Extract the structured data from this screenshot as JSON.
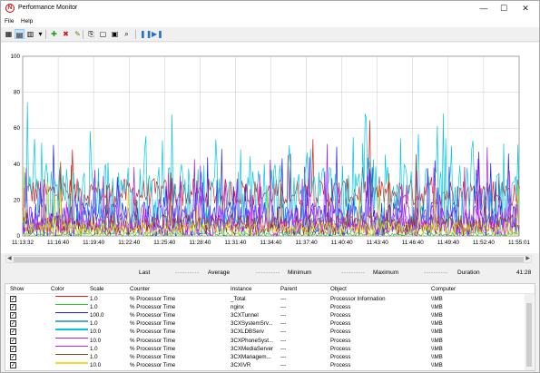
{
  "window": {
    "title": "Performance Monitor",
    "minimize": "—",
    "maximize": "☐",
    "close": "✕"
  },
  "menu": {
    "file": "File",
    "help": "Help"
  },
  "toolbar": [
    {
      "name": "view-current-activity-icon",
      "glyph": "▦"
    },
    {
      "name": "view-log-data-icon",
      "glyph": "▤",
      "selected": true
    },
    {
      "name": "change-graph-type-icon",
      "glyph": "▥"
    },
    {
      "name": "dropdown-arrow-icon",
      "glyph": "▾"
    },
    {
      "name": "add-counter-icon",
      "glyph": "✚",
      "color": "#1a9e1a"
    },
    {
      "name": "delete-counter-icon",
      "glyph": "✖",
      "color": "#d01818"
    },
    {
      "name": "highlight-icon",
      "glyph": "✎",
      "color": "#7a7a00"
    },
    {
      "name": "copy-properties-icon",
      "glyph": "⎘"
    },
    {
      "name": "paste-counter-list-icon",
      "glyph": "▢"
    },
    {
      "name": "properties-icon",
      "glyph": "▣"
    },
    {
      "name": "zoom-icon",
      "glyph": "⌕"
    },
    {
      "name": "freeze-display-icon",
      "glyph": "❚❚",
      "color": "#2a72c8"
    },
    {
      "name": "update-data-icon",
      "glyph": "▶❚",
      "color": "#2a72c8"
    }
  ],
  "chart_data": {
    "type": "line",
    "ylim": [
      0,
      100
    ],
    "yticks": [
      "0",
      "20",
      "40",
      "60",
      "80",
      "100"
    ],
    "xticks": [
      "11:13:32",
      "11:16:40",
      "11:19:40",
      "11:22:40",
      "11:25:40",
      "11:28:40",
      "11:31:40",
      "11:34:40",
      "11:37:40",
      "11:40:40",
      "11:43:40",
      "11:46:40",
      "11:49:40",
      "11:52:40",
      "11:55:01"
    ],
    "grid": true,
    "series": [
      {
        "name": "_Total",
        "color": "#e41a1a",
        "mean": 24,
        "amp": 8,
        "spikes": 0.02
      },
      {
        "name": "nginx",
        "color": "#22cc22",
        "mean": 1,
        "amp": 1,
        "spikes": 0.0
      },
      {
        "name": "3CXTunnel",
        "color": "#2020ee",
        "mean": 9,
        "amp": 10,
        "spikes": 0.12
      },
      {
        "name": "3CXSystemSrv",
        "color": "#4fa8d8",
        "mean": 6,
        "amp": 6,
        "spikes": 0.05
      },
      {
        "name": "3CXLDBServ",
        "color": "#00c8e0",
        "mean": 22,
        "amp": 18,
        "spikes": 0.18
      },
      {
        "name": "3CXPhoneSystem",
        "color": "#a020f0",
        "mean": 10,
        "amp": 8,
        "spikes": 0.08
      },
      {
        "name": "3CXMediaServer",
        "color": "#e020e0",
        "mean": 5,
        "amp": 5,
        "spikes": 0.05
      },
      {
        "name": "3CXManagement",
        "color": "#8b4513",
        "mean": 6,
        "amp": 6,
        "spikes": 0.04
      },
      {
        "name": "3CXIVR",
        "color": "#e8e020",
        "mean": 4,
        "amp": 4,
        "spikes": 0.04
      }
    ]
  },
  "scroll": {
    "left": "◀",
    "right": "▶"
  },
  "stats": {
    "last_label": "Last",
    "last_value": "----------",
    "average_label": "Average",
    "average_value": "----------",
    "minimum_label": "Minimum",
    "minimum_value": "----------",
    "maximum_label": "Maximum",
    "maximum_value": "----------",
    "duration_label": "Duration",
    "duration_value": "41:28"
  },
  "legend": {
    "headers": [
      "Show",
      "Color",
      "Scale",
      "Counter",
      "Instance",
      "Parent",
      "Object",
      "Computer"
    ],
    "rows": [
      {
        "color": "#e41a1a",
        "scale": "1.0",
        "counter": "% Processor Time",
        "instance": "_Total",
        "parent": "---",
        "object": "Processor Information",
        "computer": "\\\\MB"
      },
      {
        "color": "#22cc22",
        "scale": "1.0",
        "counter": "% Processor Time",
        "instance": "nginx",
        "parent": "---",
        "object": "Process",
        "computer": "\\\\MB"
      },
      {
        "color": "#2020ee",
        "scale": "100.0",
        "counter": "% Processor Time",
        "instance": "3CXTunnel",
        "parent": "---",
        "object": "Process",
        "computer": "\\\\MB"
      },
      {
        "color": "#4fa8d8",
        "scale": "1.0",
        "counter": "% Processor Time",
        "instance": "3CXSystemSrv...",
        "parent": "---",
        "object": "Process",
        "computer": "\\\\MB"
      },
      {
        "color": "#00c8e0",
        "scale": "10.0",
        "counter": "% Processor Time",
        "instance": "3CXLDBServ",
        "parent": "---",
        "object": "Process",
        "computer": "\\\\MB"
      },
      {
        "color": "#a020f0",
        "scale": "10.0",
        "counter": "% Processor Time",
        "instance": "3CXPhoneSyst...",
        "parent": "---",
        "object": "Process",
        "computer": "\\\\MB"
      },
      {
        "color": "#e020e0",
        "scale": "1.0",
        "counter": "% Processor Time",
        "instance": "3CXMediaServer",
        "parent": "---",
        "object": "Process",
        "computer": "\\\\MB"
      },
      {
        "color": "#8b4513",
        "scale": "1.0",
        "counter": "% Processor Time",
        "instance": "3CXManagem...",
        "parent": "---",
        "object": "Process",
        "computer": "\\\\MB"
      },
      {
        "color": "#e8e020",
        "scale": "10.0",
        "counter": "% Processor Time",
        "instance": "3CXIVR",
        "parent": "---",
        "object": "Process",
        "computer": "\\\\MB"
      }
    ]
  }
}
